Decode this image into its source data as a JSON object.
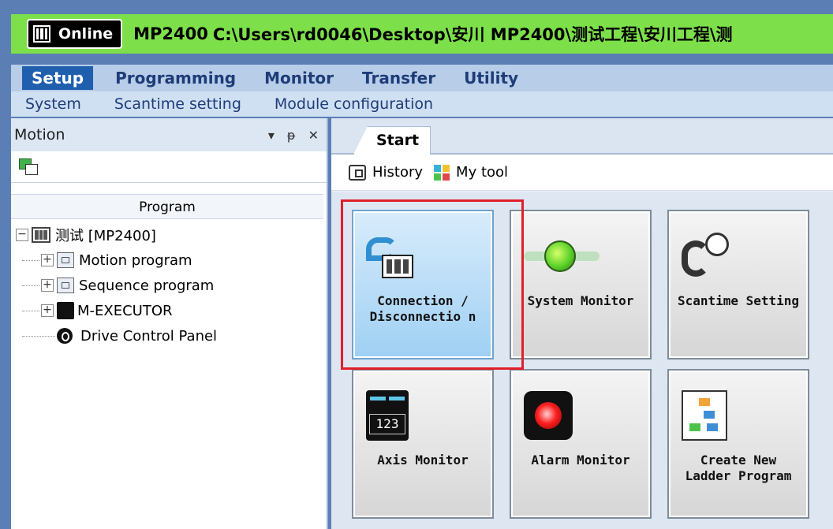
{
  "titlebar": {
    "status": "Online",
    "model": "MP2400",
    "path": "C:\\Users\\rd0046\\Desktop\\安川 MP2400\\测试工程\\安川工程\\测"
  },
  "menu": {
    "items": [
      "Setup",
      "Programming",
      "Monitor",
      "Transfer",
      "Utility"
    ],
    "active": "Setup"
  },
  "submenu": {
    "items": [
      "System",
      "Scantime setting",
      "Module configuration"
    ]
  },
  "left_panel": {
    "title": "Motion",
    "controls": [
      "▾",
      "ᵽ",
      "✕"
    ],
    "tree_header": "Program",
    "tree": {
      "root": "测试 [MP2400]",
      "children": [
        "Motion program",
        "Sequence program",
        "M-EXECUTOR",
        "Drive Control Panel"
      ]
    }
  },
  "right_area": {
    "tab": "Start",
    "toolbar": {
      "history": "History",
      "mytool": "My tool"
    },
    "tiles": [
      {
        "label": "Connection / Disconnectio n",
        "icon": "connection-icon",
        "selected": true
      },
      {
        "label": "System Monitor",
        "icon": "system-monitor-icon"
      },
      {
        "label": "Scantime Setting",
        "icon": "scantime-icon"
      },
      {
        "label": "Axis Monitor",
        "icon": "axis-monitor-icon",
        "display": "123"
      },
      {
        "label": "Alarm Monitor",
        "icon": "alarm-icon"
      },
      {
        "label": "Create New Ladder Program",
        "icon": "ladder-icon"
      }
    ]
  },
  "colors": {
    "titlebar": "#7de04a",
    "menubar": "#b7cde8",
    "accent": "#1f5fae",
    "highlight": "#e0202a"
  }
}
